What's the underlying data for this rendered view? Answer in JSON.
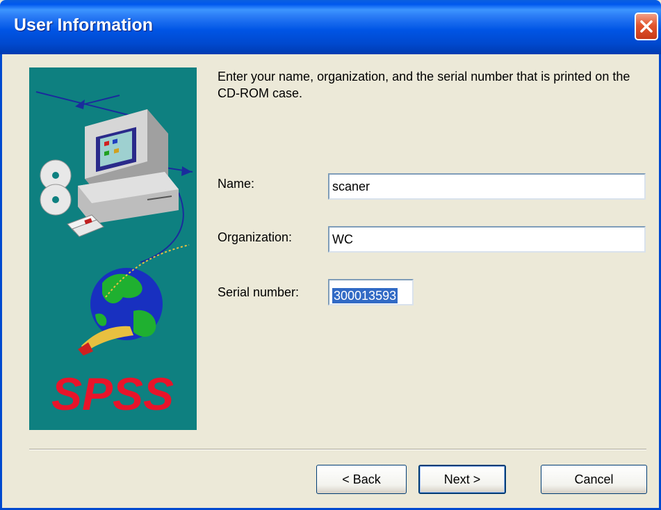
{
  "window": {
    "title": "User Information"
  },
  "instruction": "Enter your name, organization, and the serial number that is printed on the CD-ROM case.",
  "fields": {
    "name": {
      "label": "Name:",
      "value": "scaner"
    },
    "organization": {
      "label": "Organization:",
      "value": "WC"
    },
    "serial": {
      "label": "Serial number:",
      "value": "300013593"
    }
  },
  "buttons": {
    "back": "< Back",
    "next": "Next >",
    "cancel": "Cancel"
  },
  "branding": {
    "logo": "SPSS"
  },
  "colors": {
    "titlebar": "#0055E5",
    "close": "#E2562E",
    "panel": "#0E8080",
    "logo": "#E8142A",
    "selection": "#316AC5"
  }
}
